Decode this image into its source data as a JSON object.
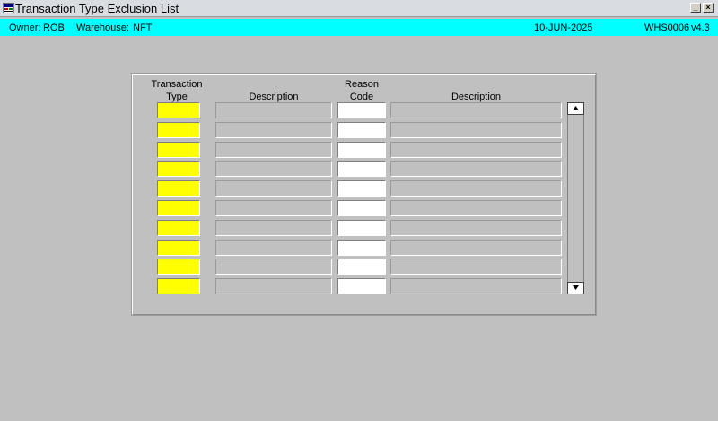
{
  "window": {
    "title": "Transaction Type Exclusion List",
    "icon": "app-form-icon"
  },
  "status": {
    "owner_label": "Owner:",
    "owner_value": "ROB",
    "warehouse_label": "Warehouse:",
    "warehouse_value": "NFT",
    "date": "10-JUN-2025",
    "module": "WHS0006",
    "version": "v4.3"
  },
  "headers": {
    "transaction_line1": "Transaction",
    "transaction_line2": "Type",
    "description1": "Description",
    "reason_line1": "Reason",
    "reason_line2": "Code",
    "description2": "Description"
  },
  "rows": [
    {
      "transaction_type": "",
      "description": "",
      "reason_code": "",
      "reason_description": ""
    },
    {
      "transaction_type": "",
      "description": "",
      "reason_code": "",
      "reason_description": ""
    },
    {
      "transaction_type": "",
      "description": "",
      "reason_code": "",
      "reason_description": ""
    },
    {
      "transaction_type": "",
      "description": "",
      "reason_code": "",
      "reason_description": ""
    },
    {
      "transaction_type": "",
      "description": "",
      "reason_code": "",
      "reason_description": ""
    },
    {
      "transaction_type": "",
      "description": "",
      "reason_code": "",
      "reason_description": ""
    },
    {
      "transaction_type": "",
      "description": "",
      "reason_code": "",
      "reason_description": ""
    },
    {
      "transaction_type": "",
      "description": "",
      "reason_code": "",
      "reason_description": ""
    },
    {
      "transaction_type": "",
      "description": "",
      "reason_code": "",
      "reason_description": ""
    },
    {
      "transaction_type": "",
      "description": "",
      "reason_code": "",
      "reason_description": ""
    }
  ],
  "colors": {
    "status_bar": "#00ffff",
    "required_field": "#ffff00",
    "background": "#c0c0c0"
  }
}
